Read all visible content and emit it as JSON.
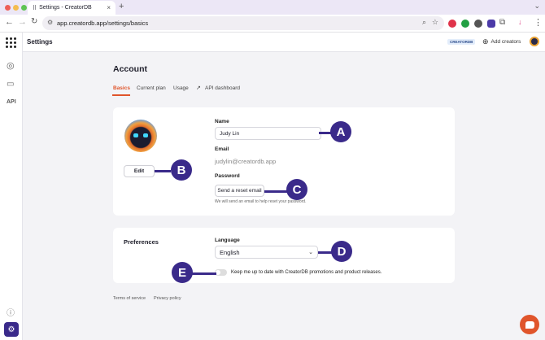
{
  "browser": {
    "tab_title": "Settings - CreatorDB",
    "url": "app.creatordb.app/settings/basics"
  },
  "colors": {
    "accent": "#e0552b",
    "callout": "#3a2a8a",
    "sidebar_active": "#3a2a8a"
  },
  "sidebar": {
    "api_label": "API"
  },
  "header": {
    "title": "Settings",
    "badge": "CREATORDB",
    "add_creators": "Add creators"
  },
  "page": {
    "heading": "Account",
    "tabs": [
      {
        "label": "Basics",
        "active": true
      },
      {
        "label": "Current plan"
      },
      {
        "label": "Usage"
      },
      {
        "label": "API dashboard"
      }
    ]
  },
  "profile": {
    "edit_label": "Edit",
    "name_label": "Name",
    "name_value": "Judy Lin",
    "email_label": "Email",
    "email_value": "judylin@creatordb.app",
    "password_label": "Password",
    "reset_button": "Send a reset email",
    "reset_hint": "We will send an email to help reset your password."
  },
  "preferences": {
    "title": "Preferences",
    "language_label": "Language",
    "language_value": "English",
    "newsletter_text": "Keep me up to date with CreatorDB promotions and product releases."
  },
  "footer": {
    "terms": "Terms of service",
    "privacy": "Privacy policy"
  },
  "callouts": {
    "a": "A",
    "b": "B",
    "c": "C",
    "d": "D",
    "e": "E"
  }
}
